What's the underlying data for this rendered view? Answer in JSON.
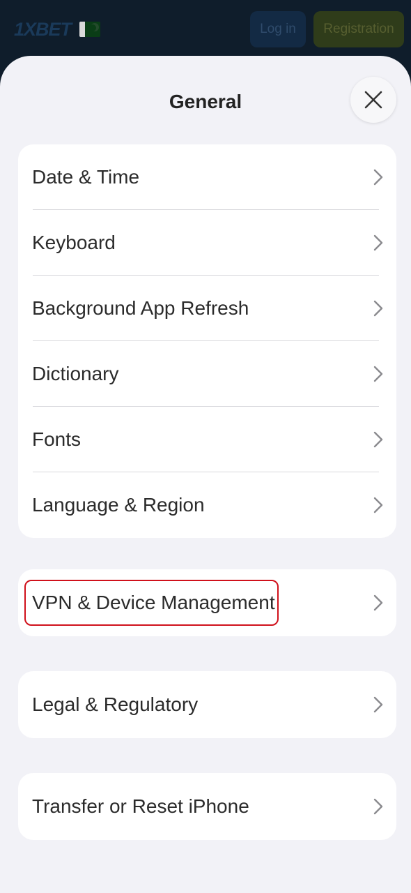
{
  "header": {
    "logo_text": "1XBET",
    "login_label": "Log in",
    "register_label": "Registration"
  },
  "sheet": {
    "title": "General",
    "close_icon": "close-icon"
  },
  "groups": [
    {
      "items": [
        {
          "label": "Date & Time"
        },
        {
          "label": "Keyboard"
        },
        {
          "label": "Background App Refresh"
        },
        {
          "label": "Dictionary"
        },
        {
          "label": "Fonts"
        },
        {
          "label": "Language & Region"
        }
      ]
    },
    {
      "items": [
        {
          "label": "VPN & Device Management",
          "highlighted": true
        }
      ]
    },
    {
      "items": [
        {
          "label": "Legal & Regulatory"
        }
      ]
    },
    {
      "items": [
        {
          "label": "Transfer or Reset iPhone"
        }
      ]
    }
  ],
  "colors": {
    "header_bg": "#0f1d2b",
    "sheet_bg": "#f2f2f7",
    "highlight": "#d0111b"
  }
}
